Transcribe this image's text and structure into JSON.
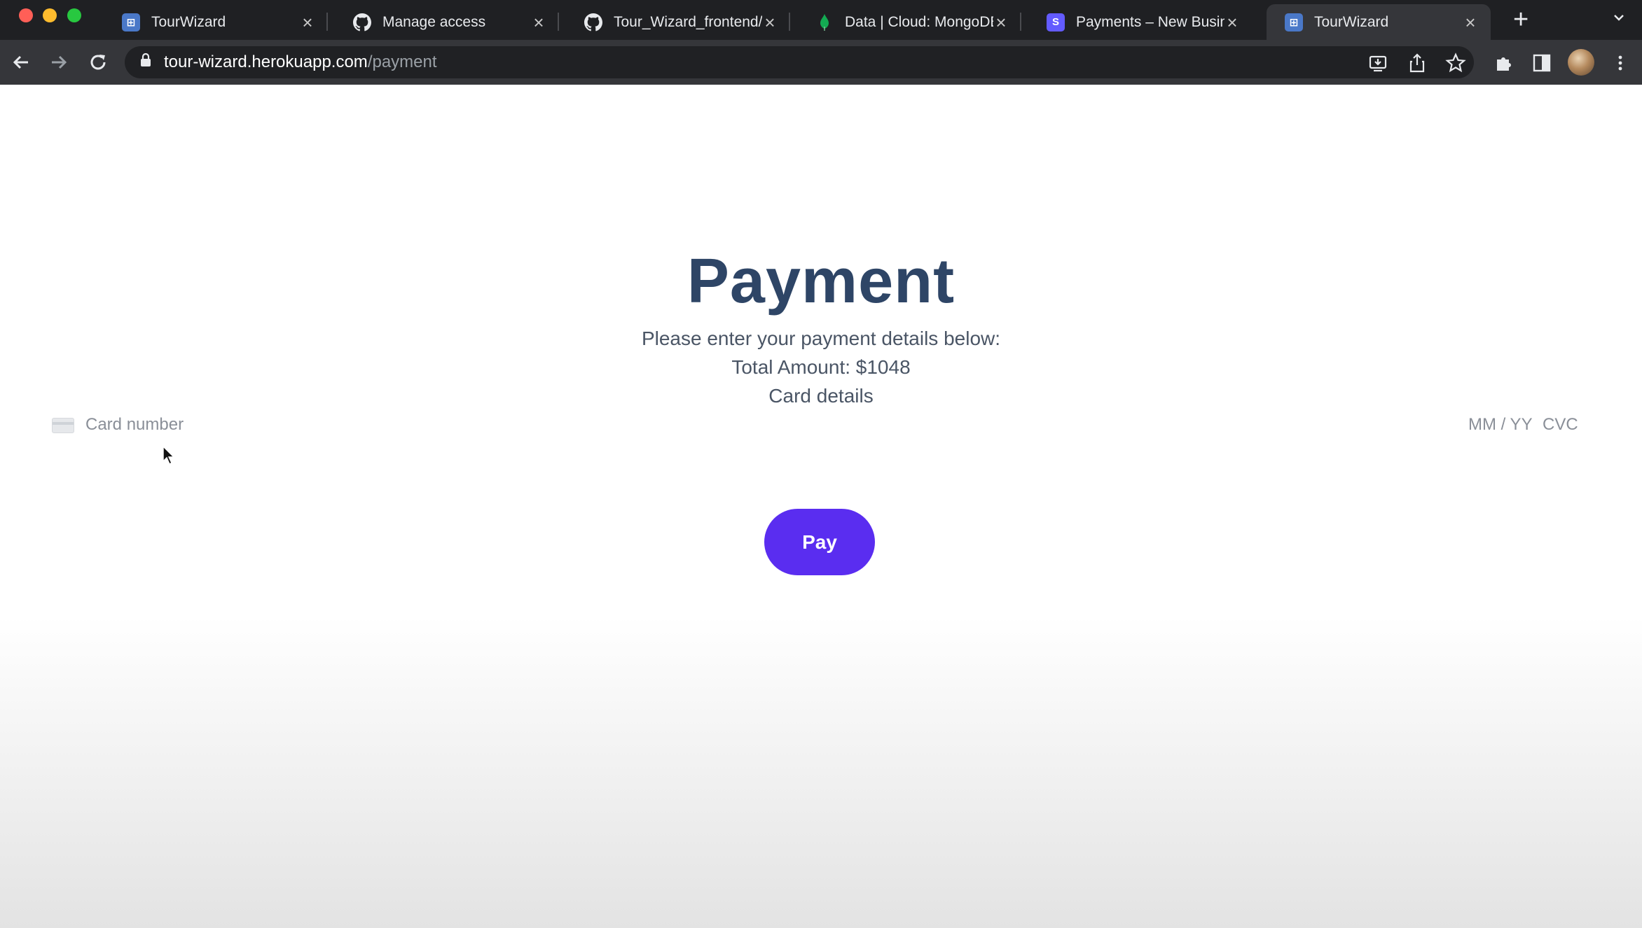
{
  "browser": {
    "tabs": [
      {
        "title": "TourWizard",
        "favicon": "tourwizard-favicon",
        "active": false
      },
      {
        "title": "Manage access",
        "favicon": "github-icon",
        "active": false
      },
      {
        "title": "Tour_Wizard_frontend/",
        "favicon": "github-icon",
        "active": false
      },
      {
        "title": "Data | Cloud: MongoDB",
        "favicon": "mongodb-leaf-icon",
        "active": false
      },
      {
        "title": "Payments – New Busin",
        "favicon": "stripe-icon",
        "active": false
      },
      {
        "title": "TourWizard",
        "favicon": "tourwizard-favicon",
        "active": true
      }
    ],
    "url_host": "tour-wizard.herokuapp.com",
    "url_path": "/payment"
  },
  "payment": {
    "heading": "Payment",
    "instruction": "Please enter your payment details below:",
    "total": "Total Amount: $1048",
    "card_details_label": "Card details",
    "card_number_placeholder": "Card number",
    "expiry_placeholder": "MM / YY",
    "cvc_placeholder": "CVC",
    "pay_button": "Pay"
  },
  "colors": {
    "heading": "#2e4566",
    "pay_button": "#5a2df0",
    "tab_strip": "#1f2023",
    "toolbar": "#35363a"
  }
}
